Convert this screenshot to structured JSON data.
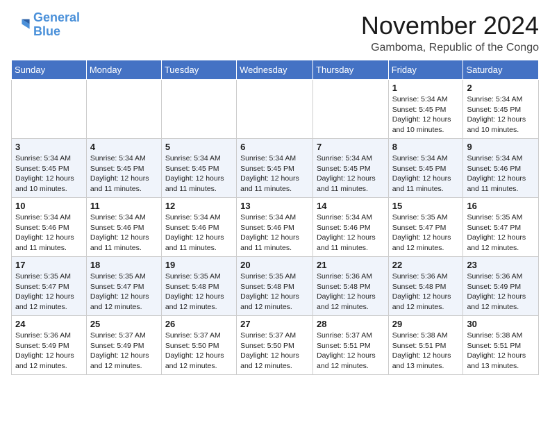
{
  "header": {
    "logo_line1": "General",
    "logo_line2": "Blue",
    "month": "November 2024",
    "location": "Gamboma, Republic of the Congo"
  },
  "weekdays": [
    "Sunday",
    "Monday",
    "Tuesday",
    "Wednesday",
    "Thursday",
    "Friday",
    "Saturday"
  ],
  "weeks": [
    [
      {
        "day": "",
        "info": ""
      },
      {
        "day": "",
        "info": ""
      },
      {
        "day": "",
        "info": ""
      },
      {
        "day": "",
        "info": ""
      },
      {
        "day": "",
        "info": ""
      },
      {
        "day": "1",
        "info": "Sunrise: 5:34 AM\nSunset: 5:45 PM\nDaylight: 12 hours\nand 10 minutes."
      },
      {
        "day": "2",
        "info": "Sunrise: 5:34 AM\nSunset: 5:45 PM\nDaylight: 12 hours\nand 10 minutes."
      }
    ],
    [
      {
        "day": "3",
        "info": "Sunrise: 5:34 AM\nSunset: 5:45 PM\nDaylight: 12 hours\nand 10 minutes."
      },
      {
        "day": "4",
        "info": "Sunrise: 5:34 AM\nSunset: 5:45 PM\nDaylight: 12 hours\nand 11 minutes."
      },
      {
        "day": "5",
        "info": "Sunrise: 5:34 AM\nSunset: 5:45 PM\nDaylight: 12 hours\nand 11 minutes."
      },
      {
        "day": "6",
        "info": "Sunrise: 5:34 AM\nSunset: 5:45 PM\nDaylight: 12 hours\nand 11 minutes."
      },
      {
        "day": "7",
        "info": "Sunrise: 5:34 AM\nSunset: 5:45 PM\nDaylight: 12 hours\nand 11 minutes."
      },
      {
        "day": "8",
        "info": "Sunrise: 5:34 AM\nSunset: 5:45 PM\nDaylight: 12 hours\nand 11 minutes."
      },
      {
        "day": "9",
        "info": "Sunrise: 5:34 AM\nSunset: 5:46 PM\nDaylight: 12 hours\nand 11 minutes."
      }
    ],
    [
      {
        "day": "10",
        "info": "Sunrise: 5:34 AM\nSunset: 5:46 PM\nDaylight: 12 hours\nand 11 minutes."
      },
      {
        "day": "11",
        "info": "Sunrise: 5:34 AM\nSunset: 5:46 PM\nDaylight: 12 hours\nand 11 minutes."
      },
      {
        "day": "12",
        "info": "Sunrise: 5:34 AM\nSunset: 5:46 PM\nDaylight: 12 hours\nand 11 minutes."
      },
      {
        "day": "13",
        "info": "Sunrise: 5:34 AM\nSunset: 5:46 PM\nDaylight: 12 hours\nand 11 minutes."
      },
      {
        "day": "14",
        "info": "Sunrise: 5:34 AM\nSunset: 5:46 PM\nDaylight: 12 hours\nand 11 minutes."
      },
      {
        "day": "15",
        "info": "Sunrise: 5:35 AM\nSunset: 5:47 PM\nDaylight: 12 hours\nand 12 minutes."
      },
      {
        "day": "16",
        "info": "Sunrise: 5:35 AM\nSunset: 5:47 PM\nDaylight: 12 hours\nand 12 minutes."
      }
    ],
    [
      {
        "day": "17",
        "info": "Sunrise: 5:35 AM\nSunset: 5:47 PM\nDaylight: 12 hours\nand 12 minutes."
      },
      {
        "day": "18",
        "info": "Sunrise: 5:35 AM\nSunset: 5:47 PM\nDaylight: 12 hours\nand 12 minutes."
      },
      {
        "day": "19",
        "info": "Sunrise: 5:35 AM\nSunset: 5:48 PM\nDaylight: 12 hours\nand 12 minutes."
      },
      {
        "day": "20",
        "info": "Sunrise: 5:35 AM\nSunset: 5:48 PM\nDaylight: 12 hours\nand 12 minutes."
      },
      {
        "day": "21",
        "info": "Sunrise: 5:36 AM\nSunset: 5:48 PM\nDaylight: 12 hours\nand 12 minutes."
      },
      {
        "day": "22",
        "info": "Sunrise: 5:36 AM\nSunset: 5:48 PM\nDaylight: 12 hours\nand 12 minutes."
      },
      {
        "day": "23",
        "info": "Sunrise: 5:36 AM\nSunset: 5:49 PM\nDaylight: 12 hours\nand 12 minutes."
      }
    ],
    [
      {
        "day": "24",
        "info": "Sunrise: 5:36 AM\nSunset: 5:49 PM\nDaylight: 12 hours\nand 12 minutes."
      },
      {
        "day": "25",
        "info": "Sunrise: 5:37 AM\nSunset: 5:49 PM\nDaylight: 12 hours\nand 12 minutes."
      },
      {
        "day": "26",
        "info": "Sunrise: 5:37 AM\nSunset: 5:50 PM\nDaylight: 12 hours\nand 12 minutes."
      },
      {
        "day": "27",
        "info": "Sunrise: 5:37 AM\nSunset: 5:50 PM\nDaylight: 12 hours\nand 12 minutes."
      },
      {
        "day": "28",
        "info": "Sunrise: 5:37 AM\nSunset: 5:51 PM\nDaylight: 12 hours\nand 12 minutes."
      },
      {
        "day": "29",
        "info": "Sunrise: 5:38 AM\nSunset: 5:51 PM\nDaylight: 12 hours\nand 13 minutes."
      },
      {
        "day": "30",
        "info": "Sunrise: 5:38 AM\nSunset: 5:51 PM\nDaylight: 12 hours\nand 13 minutes."
      }
    ]
  ]
}
